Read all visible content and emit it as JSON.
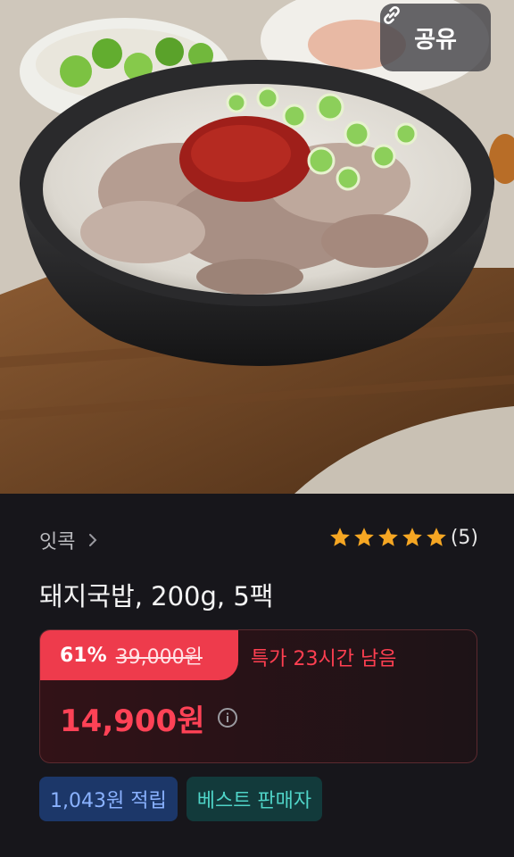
{
  "share": {
    "label": "공유",
    "icon": "link-icon"
  },
  "seller": {
    "name": "잇콕",
    "icon": "chevron-right-icon"
  },
  "rating": {
    "stars": 5,
    "count": "(5)",
    "icon": "star-icon",
    "color": "#f5a623"
  },
  "product": {
    "title": "돼지국밥, 200g, 5팩"
  },
  "deal": {
    "discount_rate": "61%",
    "original_price": "39,000원",
    "timer_text": "특가 23시간 남음",
    "sale_price": "14,900원",
    "info_icon": "info-icon",
    "accent_color": "#ee3b4c"
  },
  "badges": {
    "points": "1,043원 적립",
    "best_seller": "베스트 판매자"
  }
}
